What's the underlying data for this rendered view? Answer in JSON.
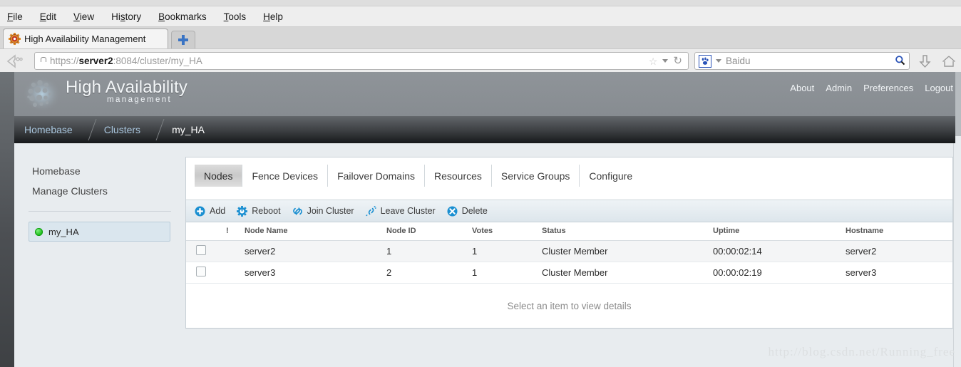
{
  "browser": {
    "menu": [
      "File",
      "Edit",
      "View",
      "History",
      "Bookmarks",
      "Tools",
      "Help"
    ],
    "tab_title": "High Availability Management",
    "url_prefix": "https://",
    "url_host": "server2",
    "url_suffix": ":8084/cluster/my_HA",
    "search_placeholder": "Baidu",
    "icons": {
      "favicon": "gear-icon",
      "new_tab": "plus-icon",
      "back": "back-arrow-icon",
      "lock": "lock-icon",
      "bookmark": "star-icon",
      "reload": "reload-icon",
      "search_engine": "baidu-paw-icon",
      "search_go": "magnifier-icon",
      "downloads": "download-arrow-icon",
      "home": "home-icon"
    }
  },
  "header": {
    "title": "High Availability",
    "subtitle": "management",
    "links": [
      "About",
      "Admin",
      "Preferences",
      "Logout"
    ]
  },
  "breadcrumb": {
    "items": [
      "Homebase",
      "Clusters",
      "my_HA"
    ]
  },
  "sidebar": {
    "nav": [
      "Homebase",
      "Manage Clusters"
    ],
    "cluster": {
      "name": "my_HA",
      "status_color": "#16bb16"
    }
  },
  "tabs": [
    {
      "label": "Nodes",
      "active": true
    },
    {
      "label": "Fence Devices",
      "active": false
    },
    {
      "label": "Failover Domains",
      "active": false
    },
    {
      "label": "Resources",
      "active": false
    },
    {
      "label": "Service Groups",
      "active": false
    },
    {
      "label": "Configure",
      "active": false
    }
  ],
  "toolbar": [
    {
      "label": "Add",
      "icon": "plus-circle-icon"
    },
    {
      "label": "Reboot",
      "icon": "gear-icon"
    },
    {
      "label": "Join Cluster",
      "icon": "link-icon"
    },
    {
      "label": "Leave Cluster",
      "icon": "broken-link-icon"
    },
    {
      "label": "Delete",
      "icon": "x-circle-icon"
    }
  ],
  "table": {
    "headers": [
      "",
      "!",
      "Node Name",
      "Node ID",
      "Votes",
      "Status",
      "Uptime",
      "Hostname"
    ],
    "rows": [
      {
        "name": "server2",
        "id": "1",
        "votes": "1",
        "status": "Cluster Member",
        "uptime": "00:00:02:14",
        "hostname": "server2"
      },
      {
        "name": "server3",
        "id": "2",
        "votes": "1",
        "status": "Cluster Member",
        "uptime": "00:00:02:19",
        "hostname": "server3"
      }
    ]
  },
  "detail": {
    "empty_message": "Select an item to view details"
  },
  "watermark": "http://blog.csdn.net/Running_free"
}
